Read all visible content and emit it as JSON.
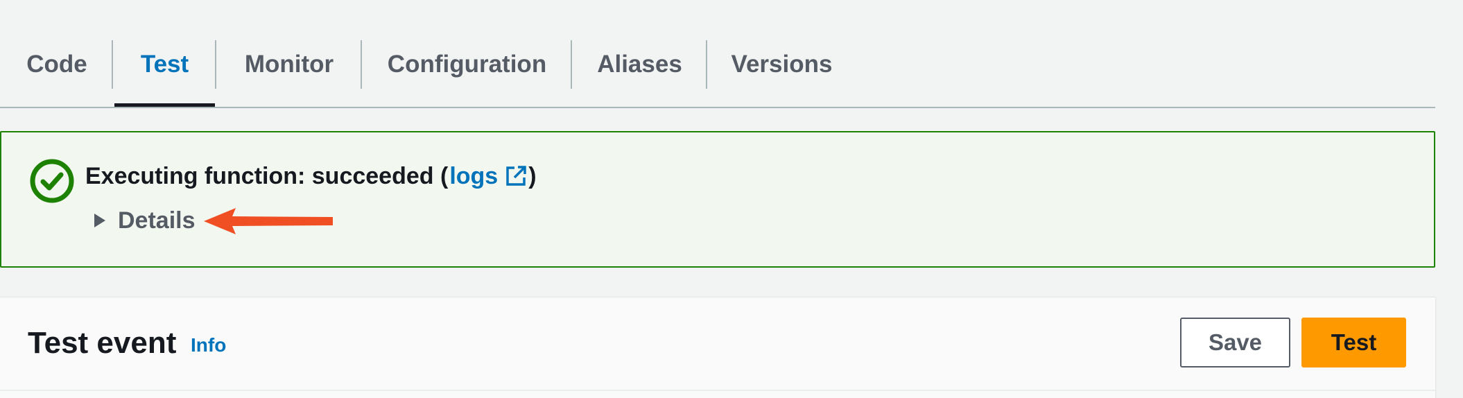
{
  "tabs": {
    "items": [
      {
        "label": "Code"
      },
      {
        "label": "Test"
      },
      {
        "label": "Monitor"
      },
      {
        "label": "Configuration"
      },
      {
        "label": "Aliases"
      },
      {
        "label": "Versions"
      }
    ],
    "active": "Test"
  },
  "alert": {
    "status": "success",
    "message": "Executing function: succeeded (",
    "link_label": "logs",
    "closing": ")",
    "details_label": "Details",
    "icons": [
      "success-check-icon",
      "external-link-icon",
      "caret-right-icon"
    ]
  },
  "annotation": {
    "type": "arrow",
    "color": "#f04e23",
    "points_to": "Details"
  },
  "test_event": {
    "title": "Test event",
    "info_label": "Info",
    "save_label": "Save",
    "test_label": "Test"
  },
  "colors": {
    "accent": "#0073bb",
    "success": "#1d8102",
    "primary_button": "#ff9900",
    "annotation": "#f04e23"
  }
}
